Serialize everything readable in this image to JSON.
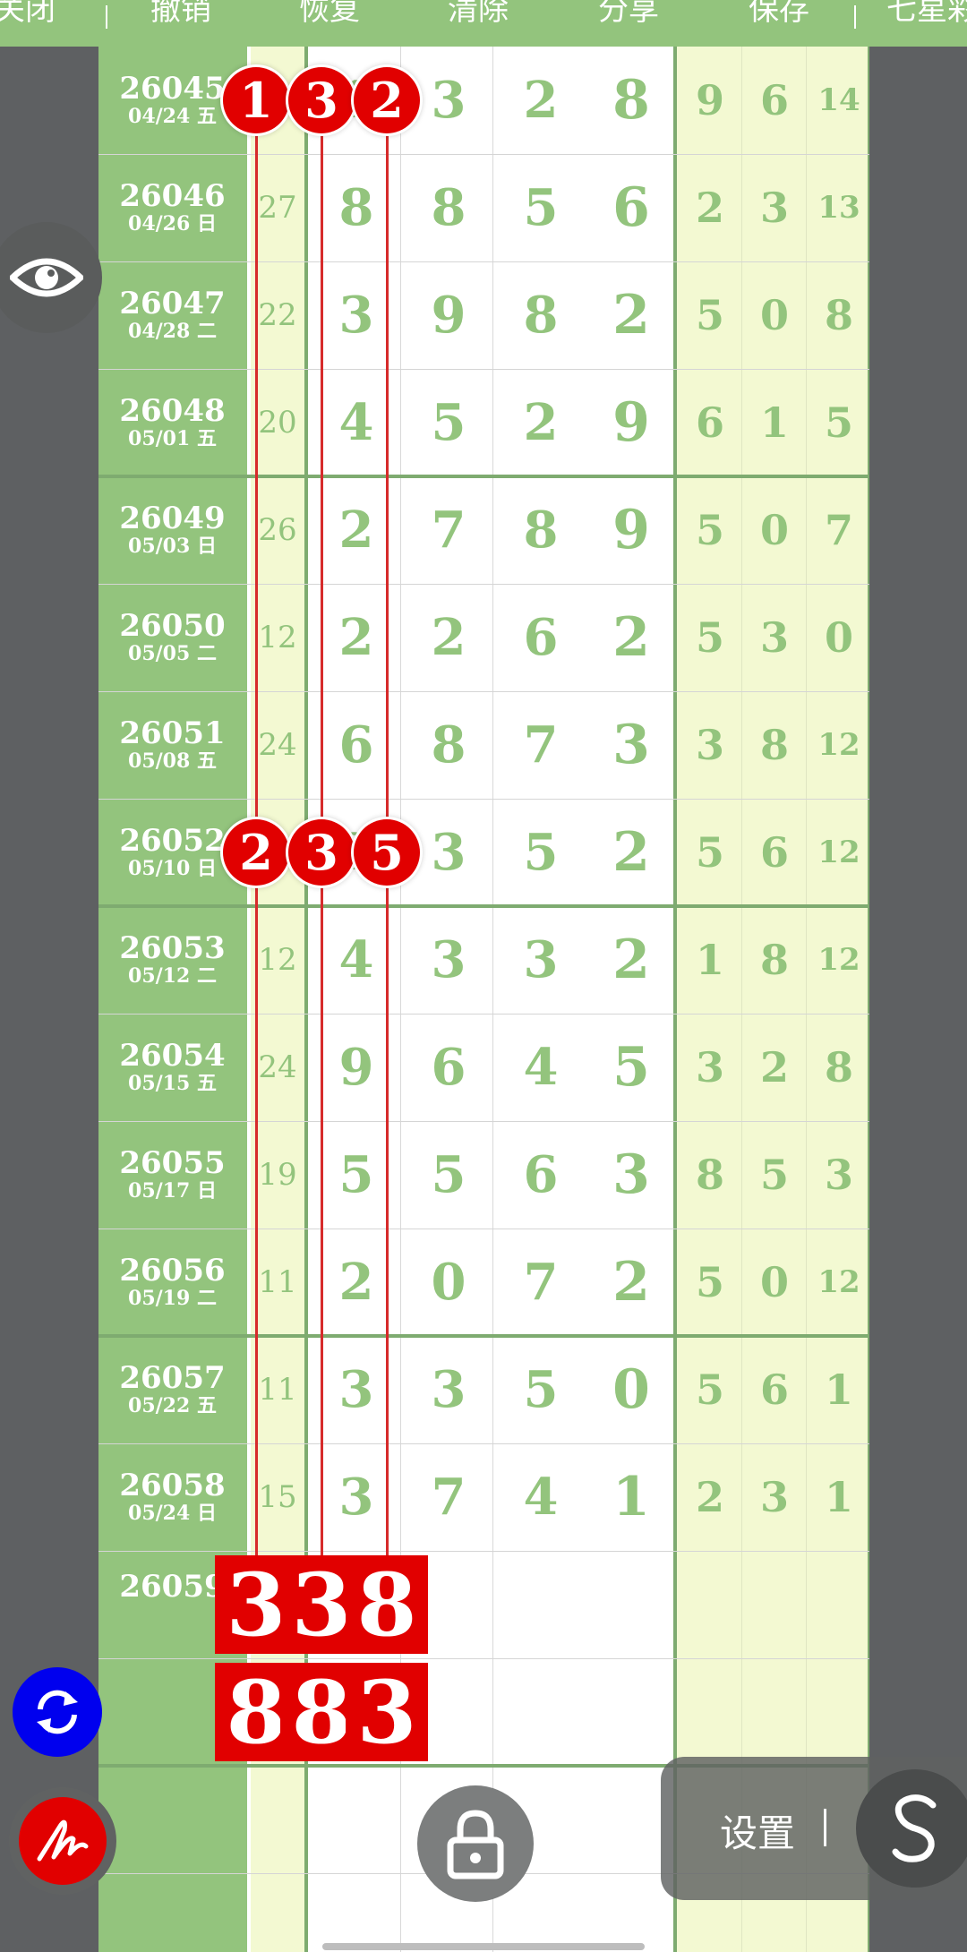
{
  "toolbar": {
    "items": [
      "关闭",
      "撤销",
      "恢复",
      "清除",
      "分享",
      "保存",
      "七星彩"
    ]
  },
  "rows": [
    {
      "issue": "26045",
      "date": "04/24 五",
      "sum": "14",
      "d": [
        "1",
        "3",
        "2"
      ],
      "tail": "8",
      "r": [
        "9",
        "6",
        "14"
      ]
    },
    {
      "issue": "26046",
      "date": "04/26 日",
      "sum": "27",
      "d": [
        "8",
        "8",
        "5"
      ],
      "tail": "6",
      "r": [
        "2",
        "3",
        "13"
      ]
    },
    {
      "issue": "26047",
      "date": "04/28 二",
      "sum": "22",
      "d": [
        "3",
        "9",
        "8"
      ],
      "tail": "2",
      "r": [
        "5",
        "0",
        "8"
      ]
    },
    {
      "issue": "26048",
      "date": "05/01 五",
      "sum": "20",
      "d": [
        "4",
        "5",
        "2"
      ],
      "tail": "9",
      "r": [
        "6",
        "1",
        "5"
      ]
    },
    {
      "issue": "26049",
      "date": "05/03 日",
      "sum": "26",
      "d": [
        "2",
        "7",
        "8"
      ],
      "tail": "9",
      "r": [
        "5",
        "0",
        "7"
      ]
    },
    {
      "issue": "26050",
      "date": "05/05 二",
      "sum": "12",
      "d": [
        "2",
        "2",
        "6"
      ],
      "tail": "2",
      "r": [
        "5",
        "3",
        "0"
      ]
    },
    {
      "issue": "26051",
      "date": "05/08 五",
      "sum": "24",
      "d": [
        "6",
        "8",
        "7"
      ],
      "tail": "3",
      "r": [
        "3",
        "8",
        "12"
      ]
    },
    {
      "issue": "26052",
      "date": "05/10 日",
      "sum": "12",
      "d": [
        "2",
        "3",
        "5"
      ],
      "tail": "2",
      "r": [
        "5",
        "6",
        "12"
      ]
    },
    {
      "issue": "26053",
      "date": "05/12 二",
      "sum": "12",
      "d": [
        "4",
        "3",
        "3"
      ],
      "tail": "2",
      "r": [
        "1",
        "8",
        "12"
      ]
    },
    {
      "issue": "26054",
      "date": "05/15 五",
      "sum": "24",
      "d": [
        "9",
        "6",
        "4"
      ],
      "tail": "5",
      "r": [
        "3",
        "2",
        "8"
      ]
    },
    {
      "issue": "26055",
      "date": "05/17 日",
      "sum": "19",
      "d": [
        "5",
        "5",
        "6"
      ],
      "tail": "3",
      "r": [
        "8",
        "5",
        "3"
      ]
    },
    {
      "issue": "26056",
      "date": "05/19 二",
      "sum": "11",
      "d": [
        "2",
        "0",
        "7"
      ],
      "tail": "2",
      "r": [
        "5",
        "0",
        "12"
      ]
    },
    {
      "issue": "26057",
      "date": "05/22 五",
      "sum": "11",
      "d": [
        "3",
        "3",
        "5"
      ],
      "tail": "0",
      "r": [
        "5",
        "6",
        "1"
      ]
    },
    {
      "issue": "26058",
      "date": "05/24 日",
      "sum": "15",
      "d": [
        "3",
        "7",
        "4"
      ],
      "tail": "1",
      "r": [
        "2",
        "3",
        "1"
      ]
    },
    {
      "issue": "26059",
      "date": "",
      "sum": "",
      "d": [
        "",
        "",
        ""
      ],
      "tail": "",
      "r": [
        "",
        "",
        ""
      ]
    },
    {
      "issue": "",
      "date": "",
      "sum": "",
      "d": [
        "",
        "",
        ""
      ],
      "tail": "",
      "r": [
        "",
        "",
        ""
      ]
    },
    {
      "issue": "",
      "date": "",
      "sum": "",
      "d": [
        "",
        "",
        ""
      ],
      "tail": "",
      "r": [
        "",
        "",
        ""
      ]
    },
    {
      "issue": "",
      "date": "",
      "sum": "",
      "d": [
        "",
        "",
        ""
      ],
      "tail": "",
      "r": [
        "",
        "",
        ""
      ]
    }
  ],
  "marks": {
    "circled_rows": [
      0,
      7
    ],
    "prediction": [
      [
        "3",
        "3",
        "8"
      ],
      [
        "8",
        "8",
        "3"
      ]
    ]
  },
  "settings": {
    "label": "设置"
  },
  "colors": {
    "toolbar_bg": "#93c47d",
    "issue_bg": "#93c47d",
    "pale_bg": "#f3f9d2",
    "digit_color": "#93c47d",
    "mark_red": "#e10000",
    "fab_blue": "#0000ee",
    "fab_red": "#e10000"
  },
  "icons": {
    "eye": "eye-icon",
    "refresh": "refresh-icon",
    "pen": "pen-signature-icon",
    "lock": "lock-icon",
    "menu_s": "s-swirl-icon"
  }
}
